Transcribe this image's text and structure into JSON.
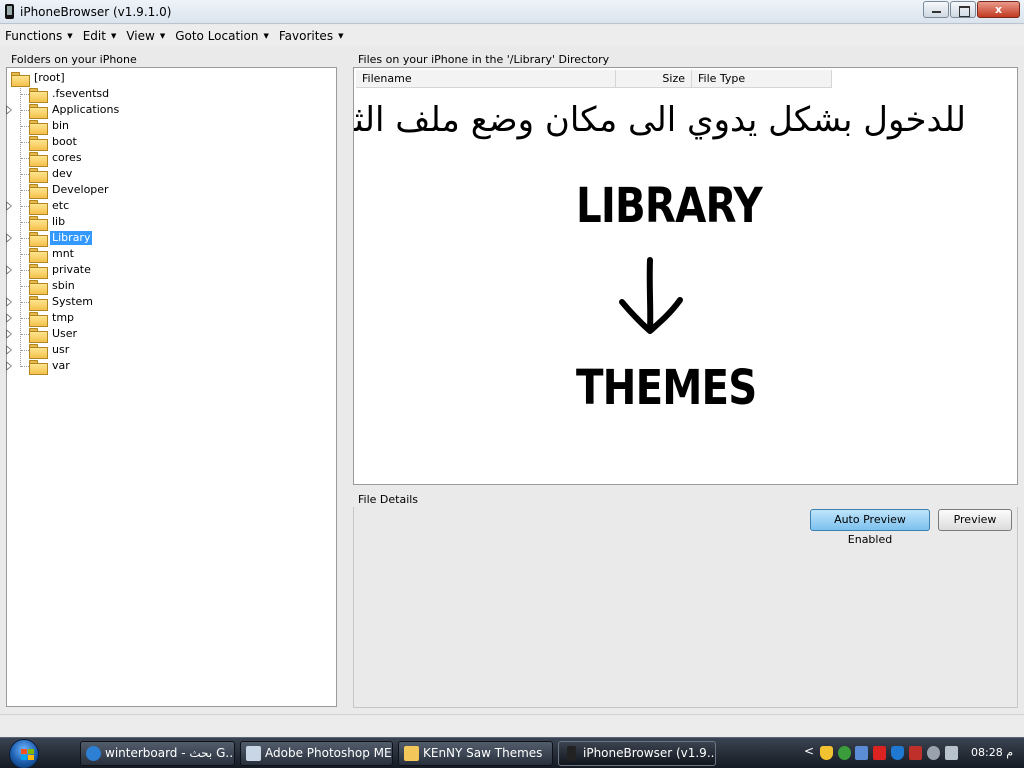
{
  "window": {
    "title": "iPhoneBrowser (v1.9.1.0)",
    "close_glyph": "x"
  },
  "menu": [
    {
      "label": "Functions"
    },
    {
      "label": "Edit"
    },
    {
      "label": "View"
    },
    {
      "label": "Goto Location"
    },
    {
      "label": "Favorites"
    }
  ],
  "folders_panel": {
    "caption": "Folders on your iPhone",
    "root": "[root]",
    "items": [
      {
        "label": ".fseventsd",
        "expandable": false
      },
      {
        "label": "Applications",
        "expandable": true
      },
      {
        "label": "bin",
        "expandable": false
      },
      {
        "label": "boot",
        "expandable": false
      },
      {
        "label": "cores",
        "expandable": false
      },
      {
        "label": "dev",
        "expandable": false
      },
      {
        "label": "Developer",
        "expandable": false
      },
      {
        "label": "etc",
        "expandable": true
      },
      {
        "label": "lib",
        "expandable": false
      },
      {
        "label": "Library",
        "expandable": true,
        "selected": true
      },
      {
        "label": "mnt",
        "expandable": false
      },
      {
        "label": "private",
        "expandable": true
      },
      {
        "label": "sbin",
        "expandable": false
      },
      {
        "label": "System",
        "expandable": true
      },
      {
        "label": "tmp",
        "expandable": true
      },
      {
        "label": "User",
        "expandable": true
      },
      {
        "label": "usr",
        "expandable": true
      },
      {
        "label": "var",
        "expandable": true
      }
    ]
  },
  "files_panel": {
    "caption": "Files on your iPhone in the '/Library' Directory",
    "columns": {
      "filename": "Filename",
      "size": "Size",
      "type": "File Type"
    },
    "overlay": {
      "arabic_text": "للدخول بشكل يدوي الى مكان وضع ملف الثيم",
      "word_top": "LIBRARY",
      "word_bottom": "THEMES"
    }
  },
  "details_panel": {
    "caption": "File Details",
    "auto_preview_label": "Auto Preview Enabled",
    "preview_label": "Preview"
  },
  "taskbar": {
    "buttons": [
      {
        "label": "winterboard - بحث G..."
      },
      {
        "label": "Adobe Photoshop ME"
      },
      {
        "label": "KEnNY Saw Themes"
      },
      {
        "label": "iPhoneBrowser (v1.9...."
      }
    ],
    "tray_chevron": "<",
    "clock": "08:28 م"
  }
}
